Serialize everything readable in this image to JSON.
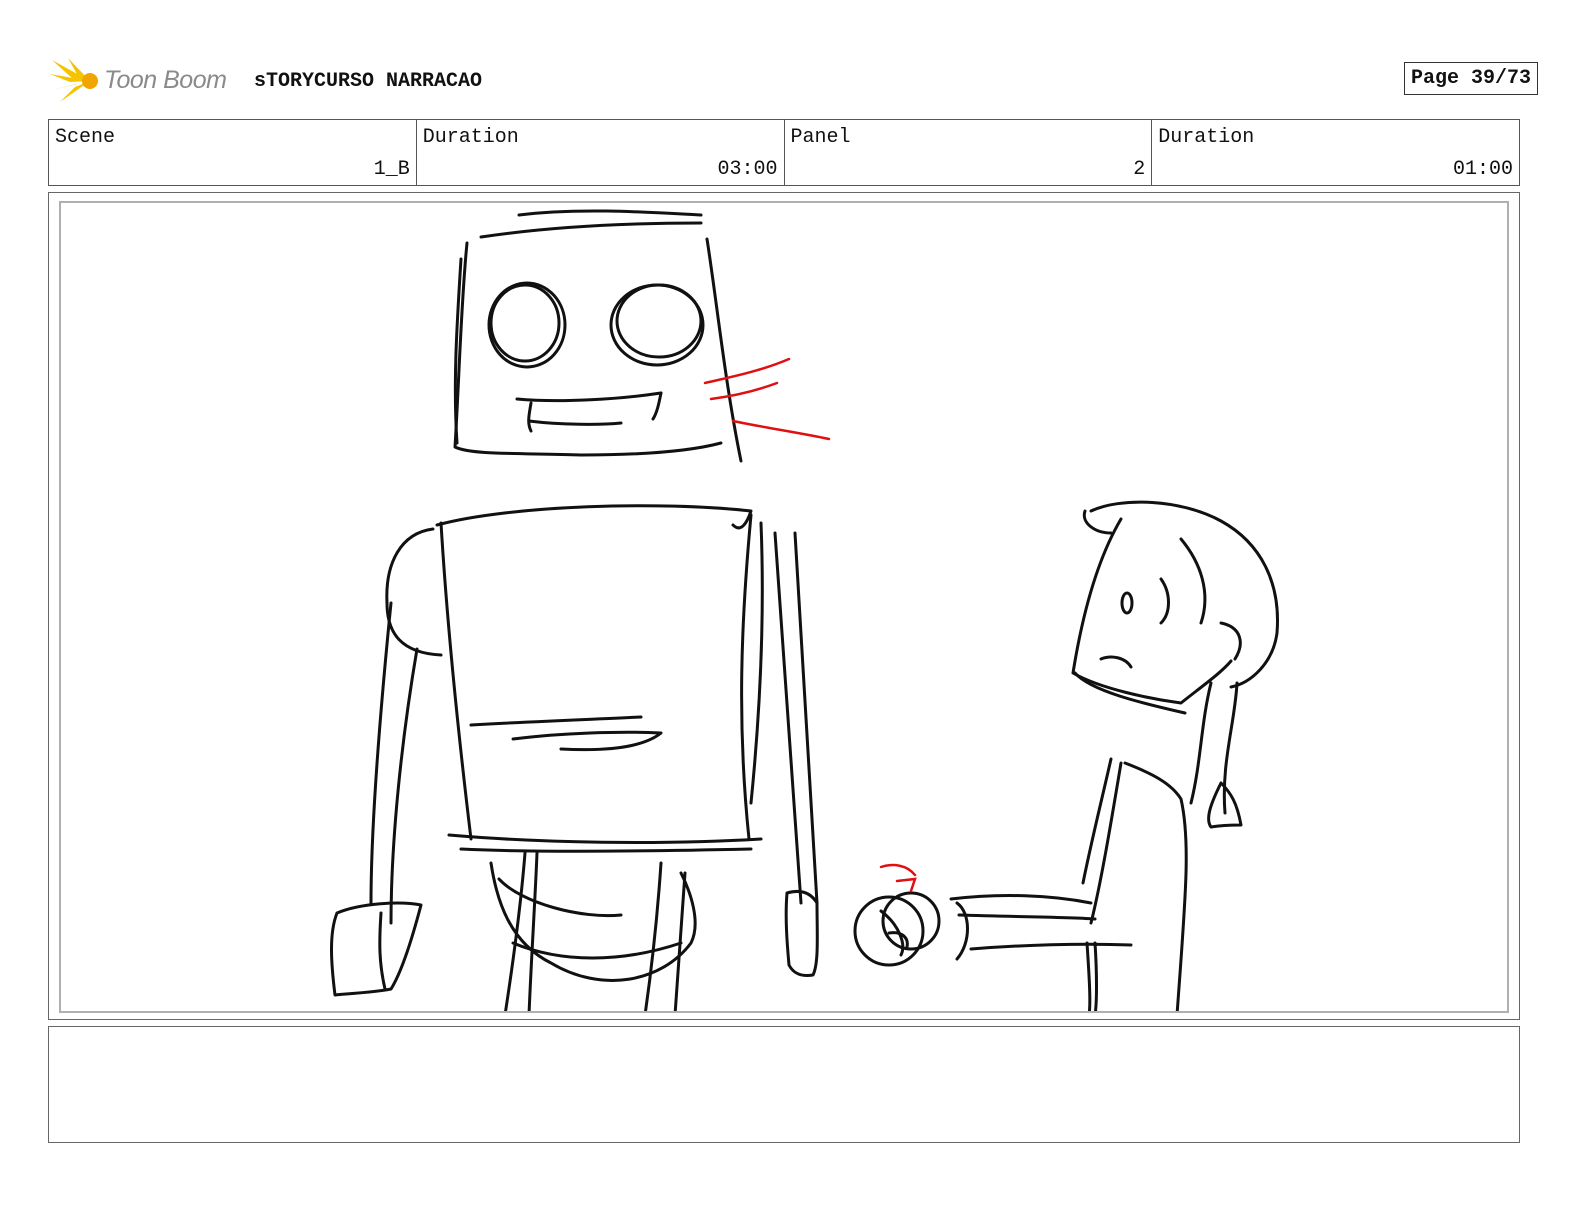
{
  "header": {
    "logo_text": "Toon Boom",
    "project_title": "sTORYCURSO NARRACAO",
    "page_label": "Page 39/73"
  },
  "info": {
    "scene_label": "Scene",
    "scene_value": "1_B",
    "scene_duration_label": "Duration",
    "scene_duration_value": "03:00",
    "panel_label": "Panel",
    "panel_value": "2",
    "panel_duration_label": "Duration",
    "panel_duration_value": "01:00"
  },
  "notes": {
    "text": ""
  },
  "colors": {
    "sketch_line": "#111111",
    "annotation_red": "#e01010",
    "logo_yellow": "#f5c400"
  }
}
